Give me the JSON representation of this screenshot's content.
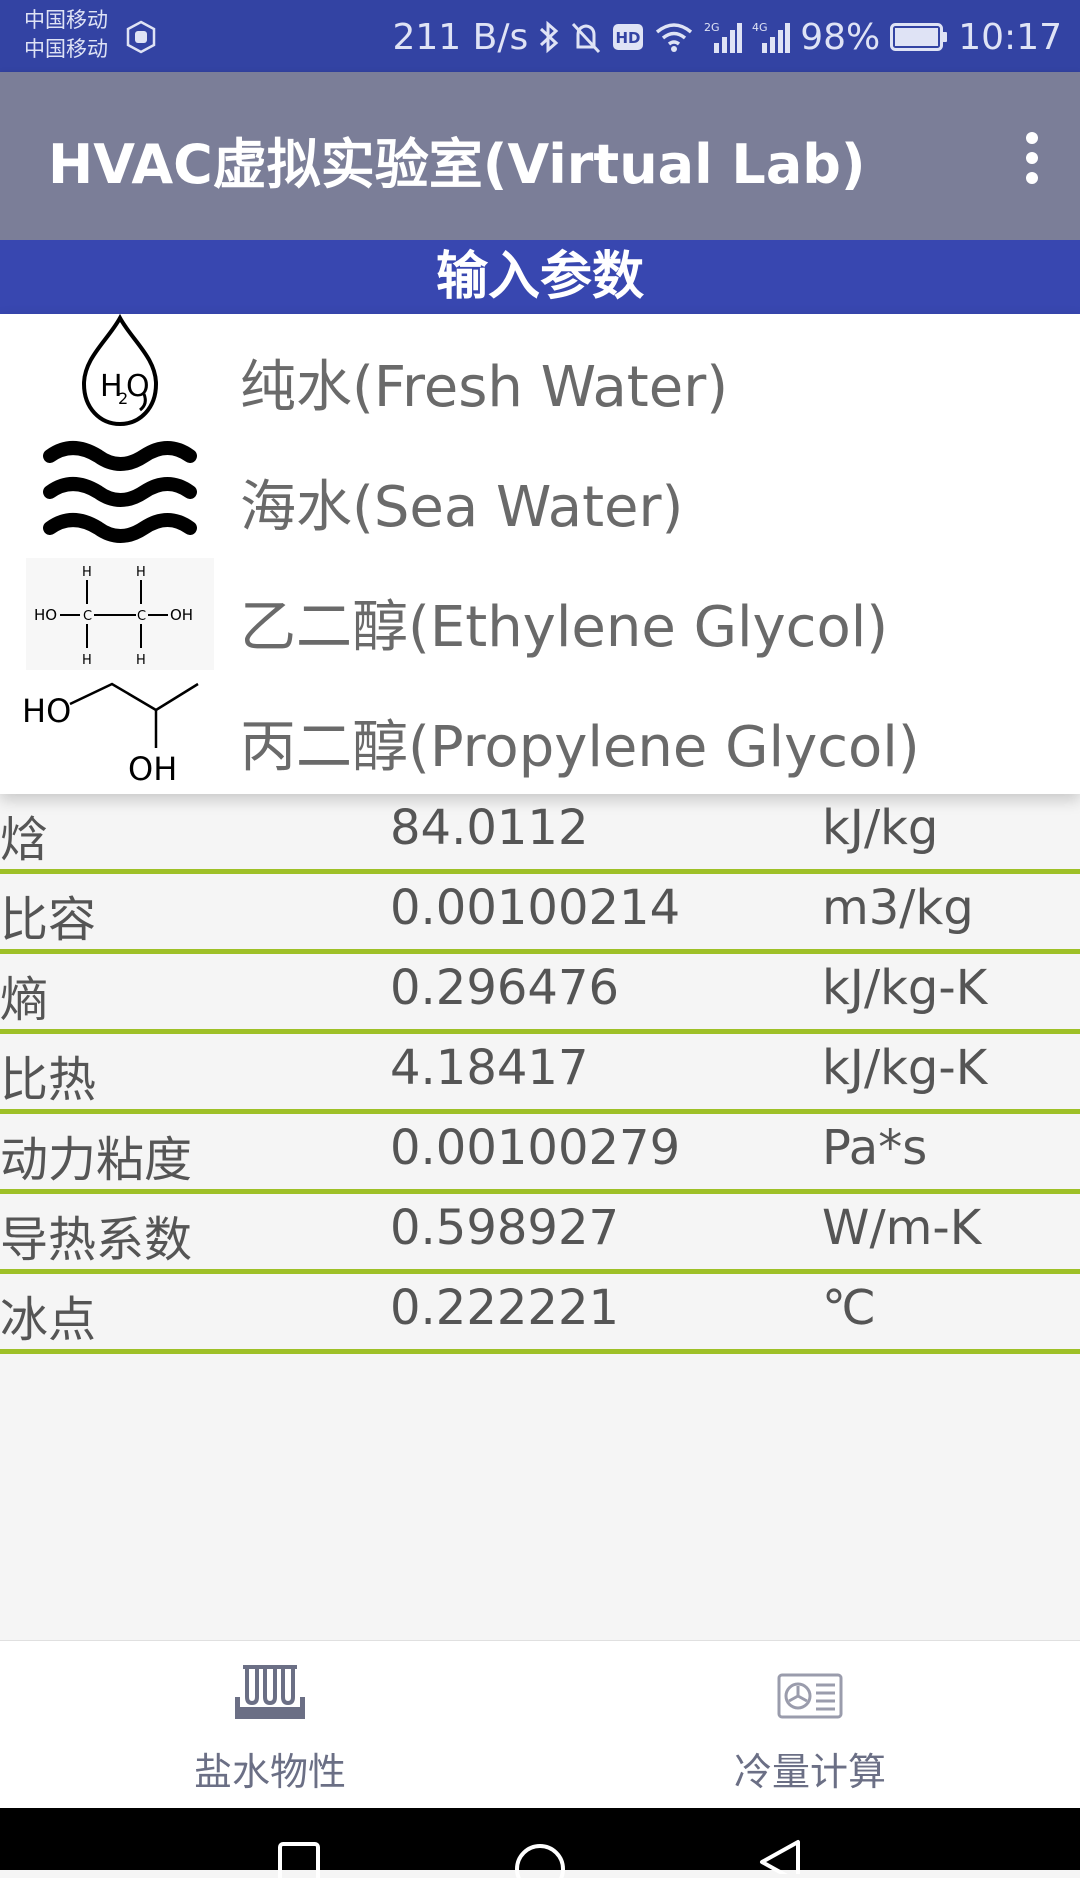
{
  "status_bar": {
    "carrier1": "中国移动",
    "carrier2": "中国移动",
    "net_speed": "211 B/s",
    "battery": "98%",
    "time": "10:17",
    "icons": [
      "bluetooth-icon",
      "mute-icon",
      "hd-icon",
      "wifi-icon",
      "signal-2g-icon",
      "signal-4g-icon",
      "battery-icon"
    ]
  },
  "app_bar": {
    "title": "HVAC虚拟实验室(Virtual Lab)",
    "overflow_icon": "more-vert-icon"
  },
  "section_header": "输入参数",
  "fluids": [
    {
      "label": "纯水(Fresh Water)",
      "icon": "water-drop-h2o-icon"
    },
    {
      "label": "海水(Sea Water)",
      "icon": "waves-icon"
    },
    {
      "label": "乙二醇(Ethylene Glycol)",
      "icon": "ethylene-glycol-structure-icon"
    },
    {
      "label": "丙二醇(Propylene Glycol)",
      "icon": "propylene-glycol-structure-icon"
    }
  ],
  "molecule_text": {
    "h2o_h": "H",
    "h2o_2": "2",
    "h2o_o": "O",
    "eg_ho": "HO",
    "eg_oh": "OH",
    "eg_h": "H",
    "eg_c": "C",
    "pg_ho": "HO",
    "pg_oh": "OH"
  },
  "properties": [
    {
      "name": "焓",
      "value": "84.0112",
      "unit": "kJ/kg"
    },
    {
      "name": "比容",
      "value": "0.00100214",
      "unit": "m3/kg"
    },
    {
      "name": "熵",
      "value": "0.296476",
      "unit": "kJ/kg-K"
    },
    {
      "name": "比热",
      "value": "4.18417",
      "unit": "kJ/kg-K"
    },
    {
      "name": "动力粘度",
      "value": "0.00100279",
      "unit": "Pa*s"
    },
    {
      "name": "导热系数",
      "value": "0.598927",
      "unit": "W/m-K"
    },
    {
      "name": "冰点",
      "value": "0.222221",
      "unit": "℃"
    }
  ],
  "bottom_nav": [
    {
      "label": "盐水物性",
      "icon": "test-tubes-icon"
    },
    {
      "label": "冷量计算",
      "icon": "ac-unit-icon"
    }
  ],
  "colors": {
    "status_bar": "#3343a3",
    "app_bar": "#7b7e98",
    "section_header": "#3847b0",
    "divider": "#9ec027"
  }
}
